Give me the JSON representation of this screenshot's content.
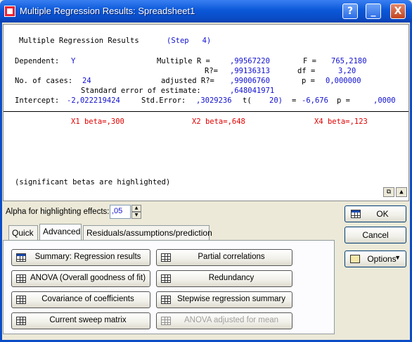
{
  "window": {
    "title": "Multiple Regression Results: Spreadsheet1",
    "help_label": "?",
    "minimize_label": "_",
    "close_label": "X"
  },
  "results": {
    "heading": "Multiple Regression Results",
    "step": "(Step   4)",
    "dependent_label": "Dependent:",
    "dependent_value": "Y",
    "multiple_r_label": "Multiple R =",
    "multiple_r_value": ",99567220",
    "f_label": "F =",
    "f_value": "765,2180",
    "r2_label": "R?=",
    "r2_value": ",99136313",
    "df_label": "df =",
    "df_value": "3,20",
    "cases_label": "No. of cases:",
    "cases_value": "24",
    "adj_r2_label": "adjusted R?=",
    "adj_r2_value": ",99006760",
    "p_label": "p =",
    "p_value": "0,000000",
    "se_label": "Standard error of estimate:",
    "se_value": ",648041971",
    "intercept_label": "Intercept:",
    "intercept_value": "-2,022219424",
    "std_error_label": "Std.Error:",
    "std_error_value": ",3029236",
    "t_label": "t(",
    "t_df": "20)",
    "t_eq": "=",
    "t_value": "-6,676",
    "p2_label": "p =",
    "p2_value": ",0000",
    "betas": [
      "X1 beta=,300",
      "X2 beta=,648",
      "X4 beta=,123"
    ],
    "note": "(significant betas are highlighted)"
  },
  "alpha": {
    "label": "Alpha for highlighting effects:",
    "value": ",05"
  },
  "tabs": [
    {
      "label": "Quick",
      "active": false
    },
    {
      "label": "Advanced",
      "active": true
    },
    {
      "label": "Residuals/assumptions/prediction",
      "active": false
    }
  ],
  "buttons": {
    "summary": "Summary:  Regression results",
    "partial": "Partial correlations",
    "anova": "ANOVA (Overall goodness of fit)",
    "redundancy": "Redundancy",
    "covariance": "Covariance of coefficients",
    "stepwise": "Stepwise regression summary",
    "sweep": "Current sweep matrix",
    "anova_mean": "ANOVA adjusted for mean"
  },
  "right_buttons": {
    "ok": "OK",
    "cancel": "Cancel",
    "options": "Options"
  }
}
